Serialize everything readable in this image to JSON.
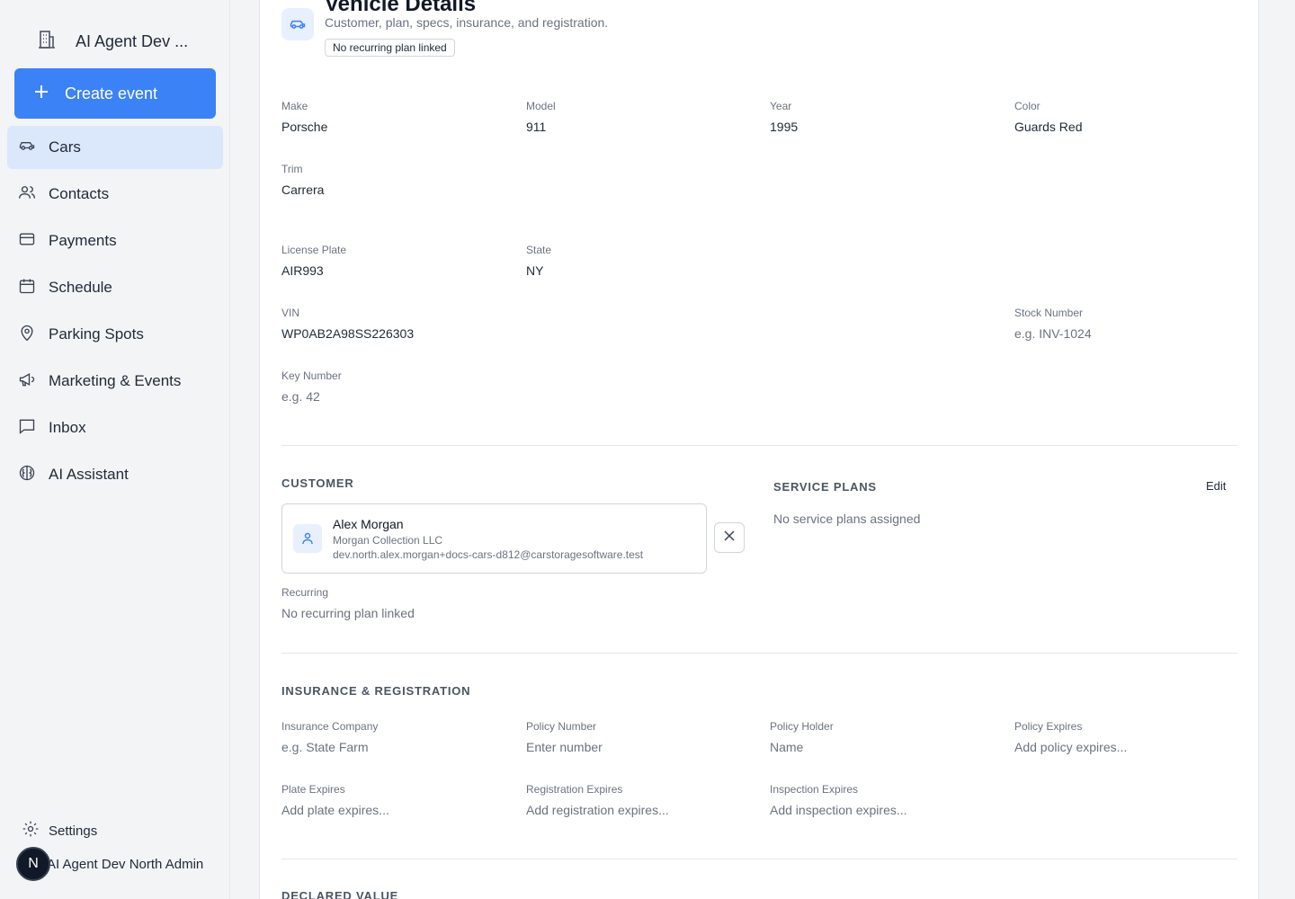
{
  "sidebar": {
    "org_name": "AI Agent Dev ...",
    "create_label": "Create event",
    "items": [
      {
        "label": "Cars",
        "icon": "car-icon"
      },
      {
        "label": "Contacts",
        "icon": "users-icon"
      },
      {
        "label": "Payments",
        "icon": "credit-card-icon"
      },
      {
        "label": "Schedule",
        "icon": "calendar-icon"
      },
      {
        "label": "Parking Spots",
        "icon": "map-pin-icon"
      },
      {
        "label": "Marketing & Events",
        "icon": "megaphone-icon"
      },
      {
        "label": "Inbox",
        "icon": "message-square-icon"
      },
      {
        "label": "AI Assistant",
        "icon": "brain-icon"
      }
    ],
    "settings_label": "Settings",
    "user_initial": "N",
    "user_name": "AI Agent Dev North Admin"
  },
  "header": {
    "title": "Vehicle Details",
    "subtitle": "Customer, plan, specs, insurance, and registration.",
    "badge": "No recurring plan linked"
  },
  "vehicle": {
    "make": {
      "label": "Make",
      "value": "Porsche"
    },
    "model": {
      "label": "Model",
      "value": "911"
    },
    "year": {
      "label": "Year",
      "value": "1995"
    },
    "color": {
      "label": "Color",
      "value": "Guards Red"
    },
    "trim": {
      "label": "Trim",
      "value": "Carrera"
    },
    "plate": {
      "label": "License Plate",
      "value": "AIR993"
    },
    "state": {
      "label": "State",
      "value": "NY"
    },
    "vin": {
      "label": "VIN",
      "value": "WP0AB2A98SS226303"
    },
    "stock": {
      "label": "Stock Number",
      "placeholder": "e.g. INV-1024"
    },
    "key": {
      "label": "Key Number",
      "placeholder": "e.g. 42"
    }
  },
  "customer": {
    "section_title": "CUSTOMER",
    "name": "Alex Morgan",
    "company": "Morgan Collection LLC",
    "email": "dev.north.alex.morgan+docs-cars-d812@carstoragesoftware.test",
    "recurring_label": "Recurring",
    "recurring_value": "No recurring plan linked"
  },
  "service_plans": {
    "section_title": "SERVICE PLANS",
    "edit_label": "Edit",
    "empty_text": "No service plans assigned"
  },
  "insurance": {
    "section_title": "INSURANCE & REGISTRATION",
    "company": {
      "label": "Insurance Company",
      "placeholder": "e.g. State Farm"
    },
    "policy_number": {
      "label": "Policy Number",
      "placeholder": "Enter number"
    },
    "policy_holder": {
      "label": "Policy Holder",
      "placeholder": "Name"
    },
    "policy_expires": {
      "label": "Policy Expires",
      "placeholder": "Add policy expires..."
    },
    "plate_expires": {
      "label": "Plate Expires",
      "placeholder": "Add plate expires..."
    },
    "registration_expires": {
      "label": "Registration Expires",
      "placeholder": "Add registration expires..."
    },
    "inspection_expires": {
      "label": "Inspection Expires",
      "placeholder": "Add inspection expires..."
    }
  },
  "declared_value": {
    "section_title": "DECLARED VALUE"
  },
  "colors": {
    "accent": "#3b82f6",
    "active_nav": "#dbe7fb",
    "icon_tint": "#e8f0fd"
  }
}
